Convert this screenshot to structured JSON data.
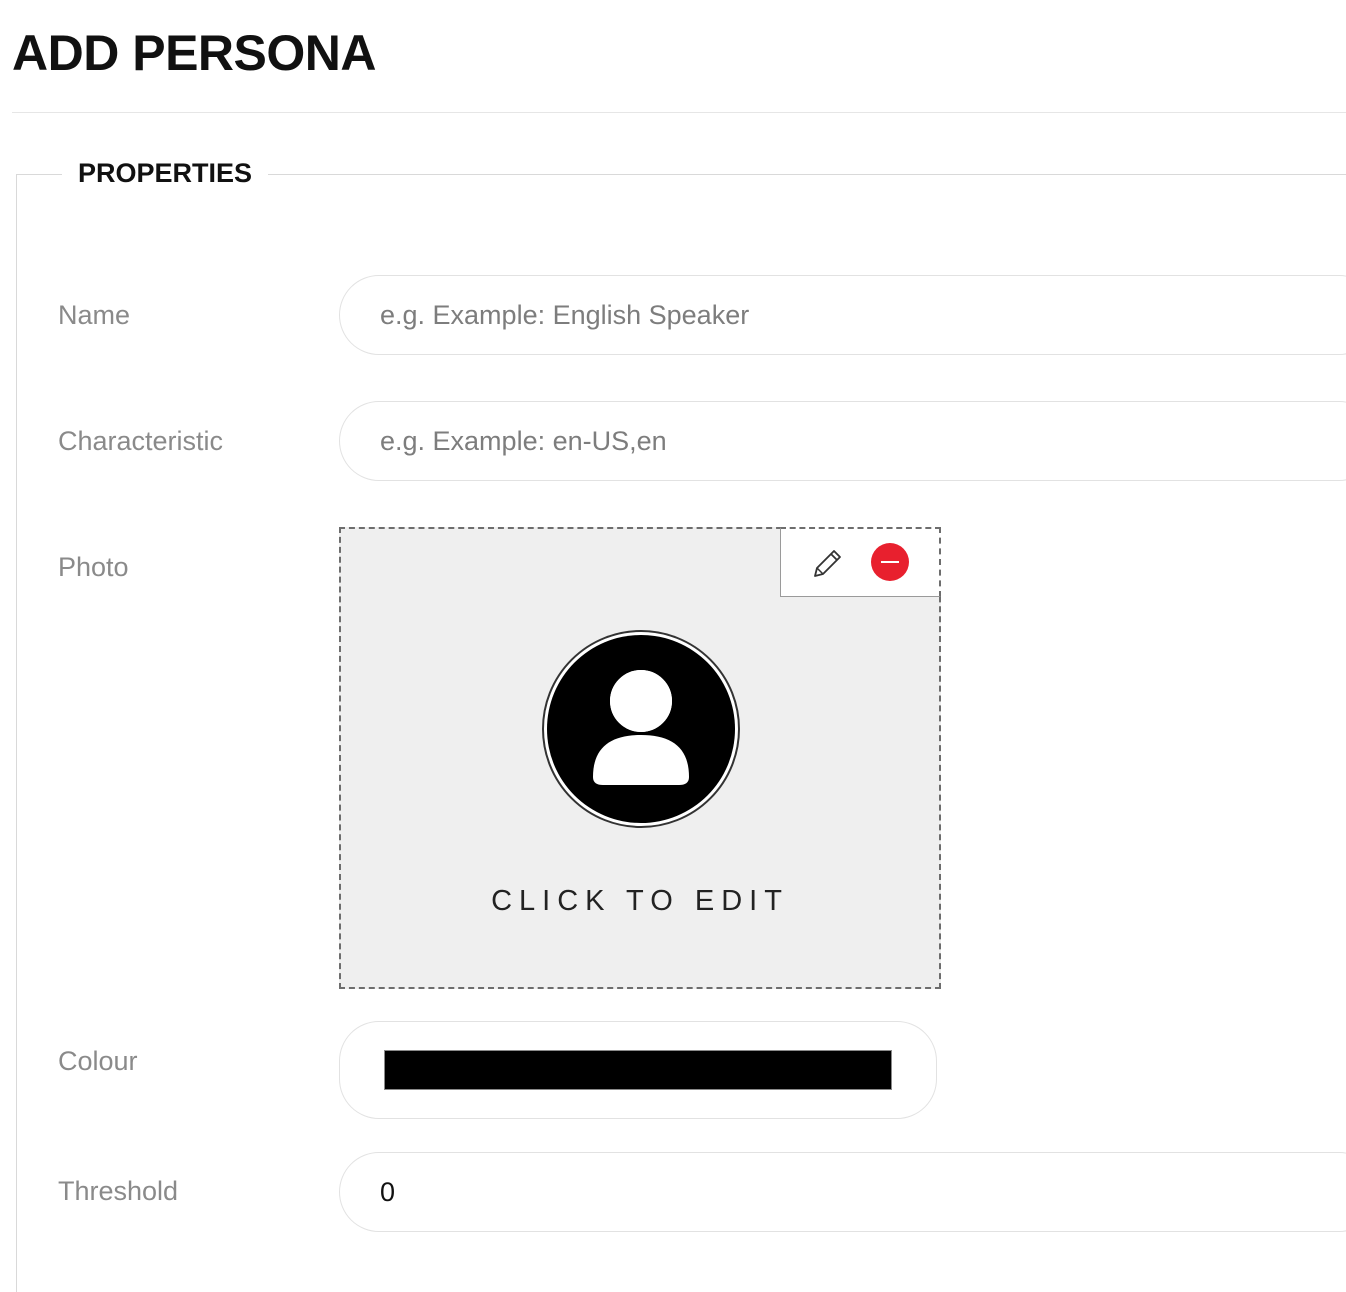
{
  "page": {
    "title": "ADD PERSONA"
  },
  "properties": {
    "legend": "PROPERTIES",
    "name": {
      "label": "Name",
      "placeholder": "e.g. Example: English Speaker",
      "value": ""
    },
    "characteristic": {
      "label": "Characteristic",
      "placeholder": "e.g. Example: en-US,en",
      "value": ""
    },
    "photo": {
      "label": "Photo",
      "caption": "CLICK TO EDIT",
      "edit_icon": "pencil-icon",
      "remove_icon": "remove-circle-icon",
      "avatar_icon": "user-avatar-icon",
      "remove_color": "#e8202e"
    },
    "colour": {
      "label": "Colour",
      "value": "#000000"
    },
    "threshold": {
      "label": "Threshold",
      "value": "0"
    }
  }
}
